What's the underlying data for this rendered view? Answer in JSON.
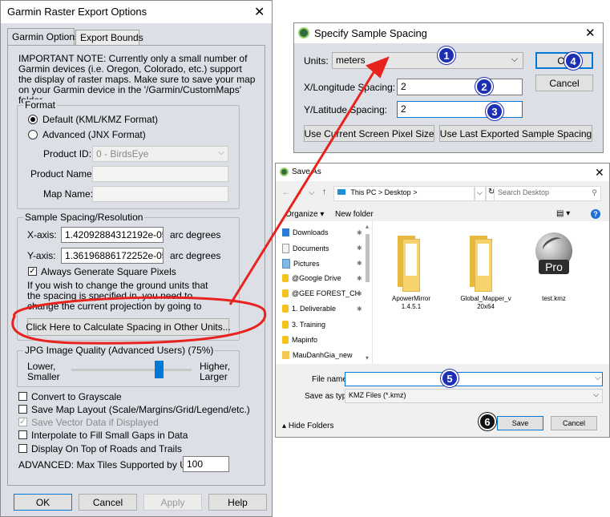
{
  "garmin": {
    "title": "Garmin Raster Export Options",
    "close": "✕",
    "tabs": [
      "Garmin Options",
      "Export Bounds"
    ],
    "note": "IMPORTANT NOTE: Currently only a small number of Garmin devices (i.e. Oregon, Colorado, etc.) support the display of raster maps. Make sure to save your map on your Garmin device in the '/Garmin/CustomMaps' folder.",
    "format": {
      "title": "Format",
      "default_label": "Default (KML/KMZ Format)",
      "advanced_label": "Advanced (JNX Format)",
      "product_id_label": "Product ID:",
      "product_id_value": "0 - BirdsEye",
      "product_name_label": "Product Name:",
      "map_name_label": "Map Name:"
    },
    "spacing": {
      "title": "Sample Spacing/Resolution",
      "x_label": "X-axis:",
      "x_value": "1.42092884312192e-05",
      "y_label": "Y-axis:",
      "y_value": "1.36196886172252e-05",
      "unit": "arc degrees",
      "square_label": "Always Generate Square Pixels",
      "info": "If you wish to change the ground units that the spacing is specified in, you need to change the current projection by going to Config->Projection.",
      "calc_button": "Click Here to Calculate Spacing in Other Units..."
    },
    "jpg": {
      "title": "JPG Image Quality (Advanced Users) (75%)",
      "lower": "Lower,",
      "smaller": "Smaller",
      "higher": "Higher,",
      "larger": "Larger",
      "quality": 0.75
    },
    "options": [
      {
        "label": "Convert to Grayscale",
        "checked": false,
        "disabled": false
      },
      {
        "label": "Save Map Layout (Scale/Margins/Grid/Legend/etc.)",
        "checked": false,
        "disabled": false
      },
      {
        "label": "Save Vector Data if Displayed",
        "checked": true,
        "disabled": true
      },
      {
        "label": "Interpolate to Fill Small Gaps in Data",
        "checked": false,
        "disabled": false
      },
      {
        "label": "Display On Top of Roads and Trails",
        "checked": false,
        "disabled": false
      }
    ],
    "max_tiles_label": "ADVANCED: Max Tiles Supported by Unit",
    "max_tiles_value": "100",
    "buttons": {
      "ok": "OK",
      "cancel": "Cancel",
      "apply": "Apply",
      "help": "Help"
    }
  },
  "spacing_dialog": {
    "title": "Specify Sample Spacing",
    "close": "✕",
    "units_label": "Units:",
    "units_value": "meters",
    "x_label": "X/Longitude Spacing:",
    "x_value": "2",
    "y_label": "Y/Latitude Spacing:",
    "y_value": "2",
    "ok": "OK",
    "cancel": "Cancel",
    "screen_btn": "Use Current Screen Pixel Size",
    "last_btn": "Use Last Exported Sample Spacing"
  },
  "save_as": {
    "title": "Save As",
    "close": "✕",
    "path": [
      "This PC",
      "Desktop"
    ],
    "search_placeholder": "Search Desktop",
    "organize": "Organize ▾",
    "new_folder": "New folder",
    "nav_items": [
      "Downloads",
      "Documents",
      "Pictures",
      "@Google Drive",
      "@GEE FOREST_CH",
      "1. Deliverable",
      "3. Training",
      "Mapinfo",
      "MauDanhGia_new"
    ],
    "files": [
      {
        "name": "ApowerMirror\n1.4.5.1",
        "kind": "folder"
      },
      {
        "name": "Global_Mapper_v\n20x64",
        "kind": "folder"
      },
      {
        "name": "test.kmz",
        "kind": "kmz"
      }
    ],
    "kmz_badge": "Pro",
    "filename_label": "File name:",
    "filename_value": "",
    "type_label": "Save as type:",
    "type_value": "KMZ Files (*.kmz)",
    "hide_folders": "Hide Folders",
    "save": "Save",
    "cancel": "Cancel"
  },
  "callouts": [
    "1",
    "2",
    "3",
    "4",
    "5",
    "6"
  ],
  "colors": {
    "annotation_red": "#e8221c",
    "callout_blue": "#1e2fb5",
    "dialog_bg": "#dcdfe6"
  }
}
